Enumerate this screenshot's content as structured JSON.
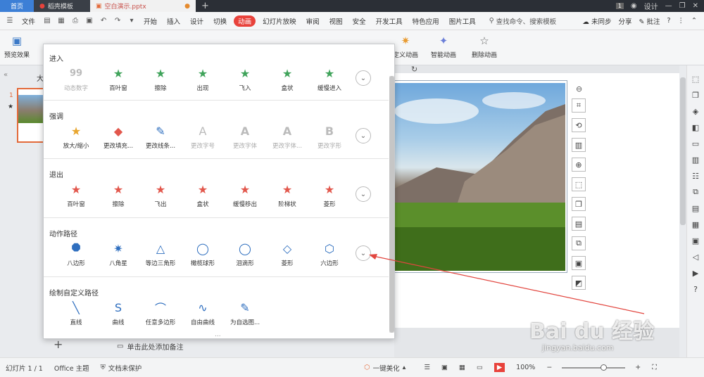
{
  "tabs": [
    {
      "label": "首页"
    },
    {
      "label": "稻壳模板"
    },
    {
      "label": "空白演示.pptx"
    }
  ],
  "window_controls": {
    "badge": "1",
    "design": "设计"
  },
  "menu": {
    "file": "文件",
    "items": [
      "开始",
      "插入",
      "设计",
      "切换",
      "动画",
      "幻灯片放映",
      "审阅",
      "视图",
      "安全",
      "开发工具",
      "特色应用",
      "图片工具"
    ],
    "active": "动画",
    "search": "查找命令、搜索模板",
    "sync": "未同步",
    "share": "分享",
    "comment": "批注",
    "help": "?"
  },
  "ribbon": {
    "preview": "预览效果",
    "custom": "定义动画",
    "smart": "智能动画",
    "delete": "删除动画"
  },
  "slide_panel": {
    "slide_number": "1",
    "star": "★",
    "placeholder_char": "大"
  },
  "panel": {
    "sections": [
      {
        "title": "进入",
        "items": [
          {
            "label": "动态数字",
            "icon": "99",
            "disabled": true
          },
          {
            "label": "百叶窗",
            "icon": "★"
          },
          {
            "label": "擦除",
            "icon": "★"
          },
          {
            "label": "出现",
            "icon": "★"
          },
          {
            "label": "飞入",
            "icon": "★"
          },
          {
            "label": "盒状",
            "icon": "★"
          },
          {
            "label": "缓慢进入",
            "icon": "★"
          }
        ]
      },
      {
        "title": "强调",
        "items": [
          {
            "label": "放大/缩小",
            "icon": "★"
          },
          {
            "label": "更改填充...",
            "icon": "◆"
          },
          {
            "label": "更改线条...",
            "icon": "✎"
          },
          {
            "label": "更改字号",
            "icon": "A",
            "disabled": true
          },
          {
            "label": "更改字体",
            "icon": "A",
            "disabled": true
          },
          {
            "label": "更改字体...",
            "icon": "A",
            "disabled": true
          },
          {
            "label": "更改字形",
            "icon": "B",
            "disabled": true
          }
        ]
      },
      {
        "title": "退出",
        "items": [
          {
            "label": "百叶窗",
            "icon": "★"
          },
          {
            "label": "擦除",
            "icon": "★"
          },
          {
            "label": "飞出",
            "icon": "★"
          },
          {
            "label": "盒状",
            "icon": "★"
          },
          {
            "label": "缓慢移出",
            "icon": "★"
          },
          {
            "label": "阶梯状",
            "icon": "★"
          },
          {
            "label": "菱形",
            "icon": "★"
          }
        ]
      },
      {
        "title": "动作路径",
        "items": [
          {
            "label": "八边形",
            "icon": "⯃"
          },
          {
            "label": "八角星",
            "icon": "✷"
          },
          {
            "label": "等边三角形",
            "icon": "△"
          },
          {
            "label": "橄榄球形",
            "icon": "◯"
          },
          {
            "label": "泪滴形",
            "icon": "◯"
          },
          {
            "label": "菱形",
            "icon": "◇"
          },
          {
            "label": "六边形",
            "icon": "⬡"
          }
        ]
      },
      {
        "title": "绘制自定义路径",
        "items": [
          {
            "label": "直线",
            "icon": "╲"
          },
          {
            "label": "曲线",
            "icon": "S"
          },
          {
            "label": "任意多边形",
            "icon": "⌒"
          },
          {
            "label": "自由曲线",
            "icon": "∿"
          },
          {
            "label": "为自选图...",
            "icon": "✎"
          }
        ]
      }
    ],
    "more_dots": "..."
  },
  "notes": {
    "text": "单击此处添加备注",
    "add": "+"
  },
  "status": {
    "slide": "幻灯片 1 / 1",
    "theme": "Office 主题",
    "protect": "文档未保护",
    "beautify": "一键美化",
    "zoom": "100%",
    "minus": "−",
    "plus": "+"
  },
  "watermark": {
    "brand": "Bai du 经验",
    "url": "jingyan.baidu.com"
  },
  "colors": {
    "accent": "#e8423b",
    "enter": "#3fa35a",
    "exit": "#e2574c",
    "path": "#2f6fbf"
  }
}
